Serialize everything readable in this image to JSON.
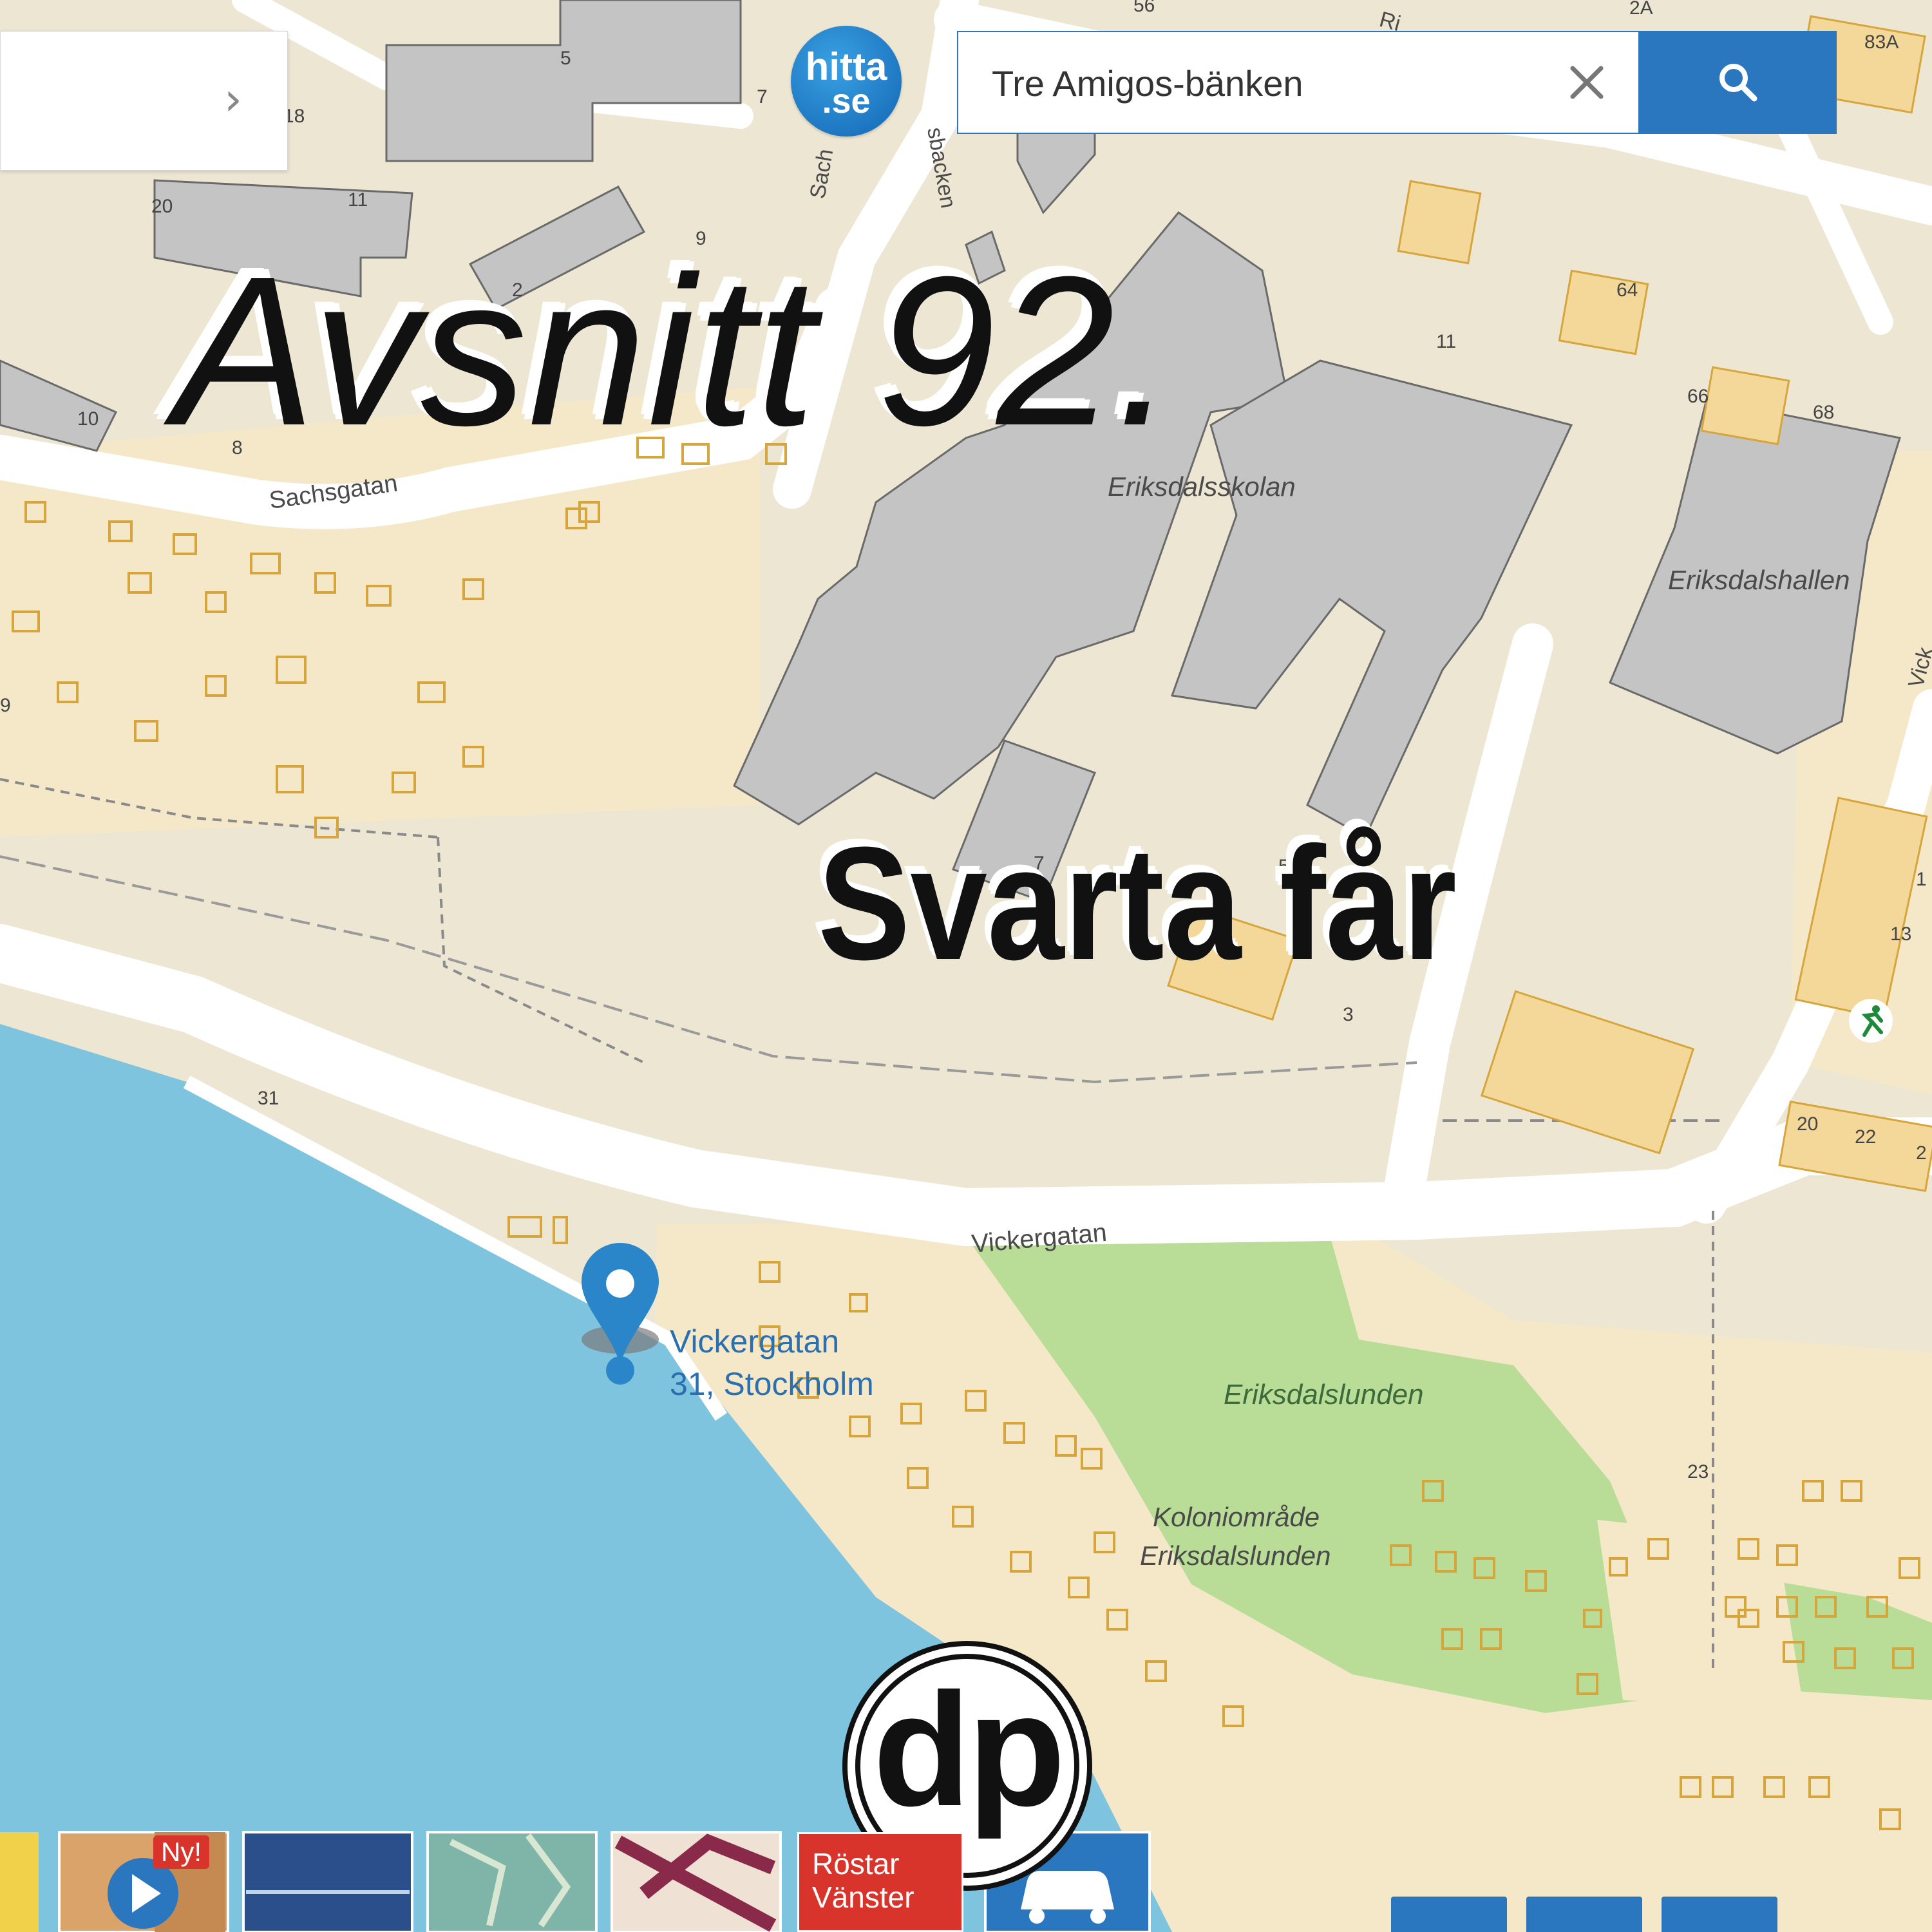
{
  "brand": {
    "logo_line1": "hitta",
    "logo_line2": ".se"
  },
  "search": {
    "query": "Tre Amigos-bänken"
  },
  "overlay": {
    "headline": "Avsnitt 92.",
    "subtitle": "Svarta får",
    "badge_text": "dp"
  },
  "pin": {
    "line1": "Vickergatan",
    "line2": "31, Stockholm"
  },
  "map_labels": {
    "street_sachsgatan": "Sachsgatan",
    "street_vickergatan": "Vickergatan",
    "street_sachs_short": "Sach",
    "street_backen": "sbacken",
    "street_ri": "Ri",
    "street_vick_right": "Vick",
    "school": "Eriksdalsskolan",
    "hall": "Eriksdalshallen",
    "park": "Eriksdalslunden",
    "colony_line1": "Koloniområde",
    "colony_line2": "Eriksdalslunden"
  },
  "house_numbers": [
    "56",
    "2A",
    "83A",
    "5",
    "7",
    "18",
    "20",
    "11",
    "9",
    "2",
    "10",
    "8",
    "64",
    "11",
    "66",
    "68",
    "31",
    "3",
    "5",
    "7",
    "13",
    "1",
    "9",
    "20",
    "22",
    "2",
    "23"
  ],
  "bottom_bar": {
    "new_badge": "Ny!",
    "rostar_line1": "Röstar",
    "rostar_line2": "Vänster"
  },
  "colors": {
    "accent": "#2a77c0",
    "water": "#7ec4de",
    "park": "#b9dd97",
    "land": "#ede6d3",
    "building": "#c4c4c4",
    "plot": "#f3d89a"
  }
}
